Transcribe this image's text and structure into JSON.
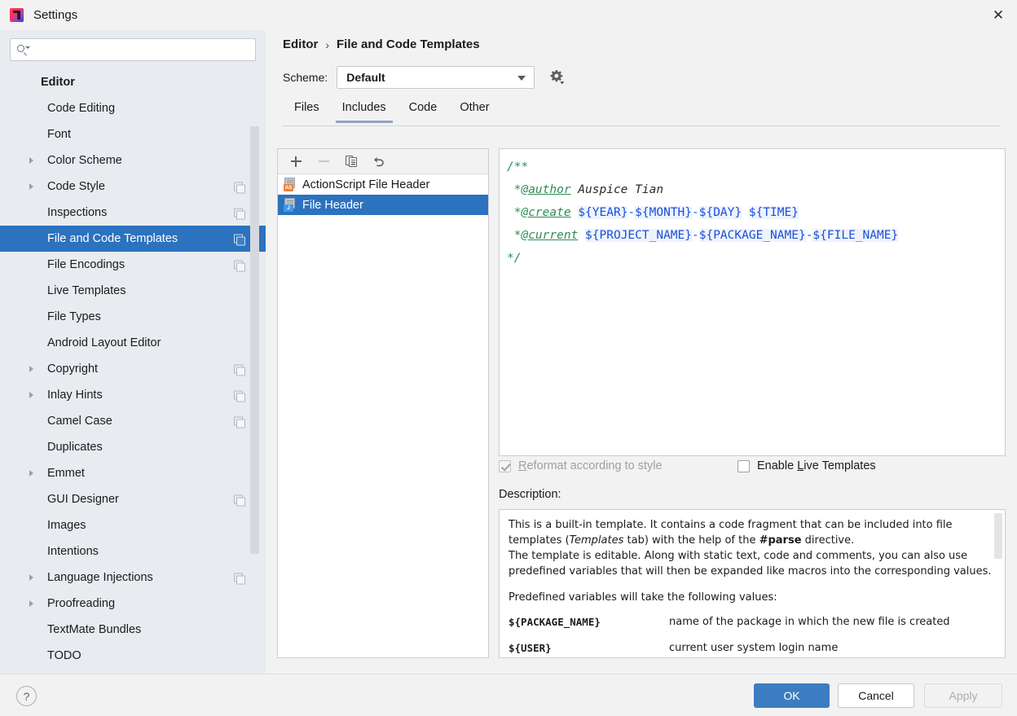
{
  "window": {
    "title": "Settings",
    "close_label": "✕",
    "app_icon": "intellij-idea-icon"
  },
  "search": {
    "value": "",
    "placeholder": "",
    "icon": "search-icon"
  },
  "sidebar": {
    "items": [
      {
        "label": "Editor",
        "indent": 0,
        "group": true,
        "arrow": false,
        "badge": false,
        "selected": false
      },
      {
        "label": "Code Editing",
        "indent": 1,
        "group": false,
        "arrow": false,
        "badge": false,
        "selected": false
      },
      {
        "label": "Font",
        "indent": 1,
        "group": false,
        "arrow": false,
        "badge": false,
        "selected": false
      },
      {
        "label": "Color Scheme",
        "indent": 1,
        "group": false,
        "arrow": true,
        "badge": false,
        "selected": false
      },
      {
        "label": "Code Style",
        "indent": 1,
        "group": false,
        "arrow": true,
        "badge": true,
        "selected": false
      },
      {
        "label": "Inspections",
        "indent": 1,
        "group": false,
        "arrow": false,
        "badge": true,
        "selected": false
      },
      {
        "label": "File and Code Templates",
        "indent": 1,
        "group": false,
        "arrow": false,
        "badge": true,
        "selected": true
      },
      {
        "label": "File Encodings",
        "indent": 1,
        "group": false,
        "arrow": false,
        "badge": true,
        "selected": false
      },
      {
        "label": "Live Templates",
        "indent": 1,
        "group": false,
        "arrow": false,
        "badge": false,
        "selected": false
      },
      {
        "label": "File Types",
        "indent": 1,
        "group": false,
        "arrow": false,
        "badge": false,
        "selected": false
      },
      {
        "label": "Android Layout Editor",
        "indent": 1,
        "group": false,
        "arrow": false,
        "badge": false,
        "selected": false
      },
      {
        "label": "Copyright",
        "indent": 1,
        "group": false,
        "arrow": true,
        "badge": true,
        "selected": false
      },
      {
        "label": "Inlay Hints",
        "indent": 1,
        "group": false,
        "arrow": true,
        "badge": true,
        "selected": false
      },
      {
        "label": "Camel Case",
        "indent": 1,
        "group": false,
        "arrow": false,
        "badge": true,
        "selected": false
      },
      {
        "label": "Duplicates",
        "indent": 1,
        "group": false,
        "arrow": false,
        "badge": false,
        "selected": false
      },
      {
        "label": "Emmet",
        "indent": 1,
        "group": false,
        "arrow": true,
        "badge": false,
        "selected": false
      },
      {
        "label": "GUI Designer",
        "indent": 1,
        "group": false,
        "arrow": false,
        "badge": true,
        "selected": false
      },
      {
        "label": "Images",
        "indent": 1,
        "group": false,
        "arrow": false,
        "badge": false,
        "selected": false
      },
      {
        "label": "Intentions",
        "indent": 1,
        "group": false,
        "arrow": false,
        "badge": false,
        "selected": false
      },
      {
        "label": "Language Injections",
        "indent": 1,
        "group": false,
        "arrow": true,
        "badge": true,
        "selected": false
      },
      {
        "label": "Proofreading",
        "indent": 1,
        "group": false,
        "arrow": true,
        "badge": false,
        "selected": false
      },
      {
        "label": "TextMate Bundles",
        "indent": 1,
        "group": false,
        "arrow": false,
        "badge": false,
        "selected": false
      },
      {
        "label": "TODO",
        "indent": 1,
        "group": false,
        "arrow": false,
        "badge": false,
        "selected": false
      }
    ]
  },
  "breadcrumb": {
    "parent": "Editor",
    "separator": "›",
    "current": "File and Code Templates"
  },
  "scheme": {
    "label": "Scheme:",
    "value": "Default",
    "gear_icon": "gear-icon"
  },
  "tabs": [
    {
      "label": "Files",
      "active": false
    },
    {
      "label": "Includes",
      "active": true
    },
    {
      "label": "Code",
      "active": false
    },
    {
      "label": "Other",
      "active": false
    }
  ],
  "list_toolbar": [
    {
      "icon": "plus-icon",
      "enabled": true
    },
    {
      "icon": "minus-icon",
      "enabled": false
    },
    {
      "icon": "copy-icon",
      "enabled": true
    },
    {
      "icon": "revert-icon",
      "enabled": true
    }
  ],
  "templates": [
    {
      "label": "ActionScript File Header",
      "badge": "AS",
      "badge_color": "#e8833a",
      "selected": false
    },
    {
      "label": "File Header",
      "badge": "J",
      "badge_color": "#3d9ae8",
      "selected": true
    }
  ],
  "editor": {
    "lines": [
      {
        "segments": [
          {
            "text": "/**",
            "style": "cm"
          }
        ]
      },
      {
        "segments": [
          {
            "text": " *",
            "style": "cm"
          },
          {
            "text": "@author",
            "style": "cm-u"
          },
          {
            "text": " Auspice Tian",
            "style": "cm-plain"
          }
        ]
      },
      {
        "segments": [
          {
            "text": " *",
            "style": "cm"
          },
          {
            "text": "@create",
            "style": "cm-u"
          },
          {
            "text": " ",
            "style": "cm-plain"
          },
          {
            "text": "${YEAR}",
            "style": "var"
          },
          {
            "text": "-",
            "style": "dash"
          },
          {
            "text": "${MONTH}",
            "style": "var"
          },
          {
            "text": "-",
            "style": "dash"
          },
          {
            "text": "${DAY}",
            "style": "var"
          },
          {
            "text": " ",
            "style": "cm-plain"
          },
          {
            "text": "${TIME}",
            "style": "var"
          }
        ]
      },
      {
        "segments": [
          {
            "text": " *",
            "style": "cm"
          },
          {
            "text": "@current",
            "style": "cm-u"
          },
          {
            "text": " ",
            "style": "cm-plain"
          },
          {
            "text": "${PROJECT_NAME}",
            "style": "var"
          },
          {
            "text": "-",
            "style": "dash"
          },
          {
            "text": "${PACKAGE_NAME}",
            "style": "var"
          },
          {
            "text": "-",
            "style": "dash"
          },
          {
            "text": "${FILE_NAME}",
            "style": "var"
          }
        ]
      },
      {
        "segments": [
          {
            "text": "*/",
            "style": "cm"
          }
        ]
      }
    ]
  },
  "options": {
    "reformat": {
      "label_before": "R",
      "label_after": "eformat according to style",
      "checked": true,
      "enabled": false
    },
    "live_templates": {
      "label_before": "Enable ",
      "mnemonic": "L",
      "label_after": "ive Templates",
      "checked": false,
      "enabled": true
    }
  },
  "description": {
    "label": "Description:",
    "paragraph1_a": "This is a built-in template. It contains a code fragment that can be included into file templates (",
    "paragraph1_em": "Templates",
    "paragraph1_b": " tab) with the help of the ",
    "paragraph1_bold": "#parse",
    "paragraph1_c": " directive.",
    "paragraph2": "The template is editable. Along with static text, code and comments, you can also use predefined variables that will then be expanded like macros into the corresponding values.",
    "paragraph3": "Predefined variables will take the following values:",
    "variables": [
      {
        "name": "${PACKAGE_NAME}",
        "desc": "name of the package in which the new file is created"
      },
      {
        "name": "${USER}",
        "desc": "current user system login name"
      }
    ]
  },
  "footer": {
    "help_label": "?",
    "ok": "OK",
    "cancel": "Cancel",
    "apply": "Apply",
    "apply_enabled": false
  },
  "colors": {
    "selection_blue": "#2b72bf",
    "primary_button": "#3b7dc0",
    "sidebar_bg": "#e8ecf0",
    "panel_bg": "#f2f2f2",
    "comment_green": "#2e8b57",
    "variable_blue": "#1a4fd6",
    "tab_underline": "#93a4bd"
  }
}
